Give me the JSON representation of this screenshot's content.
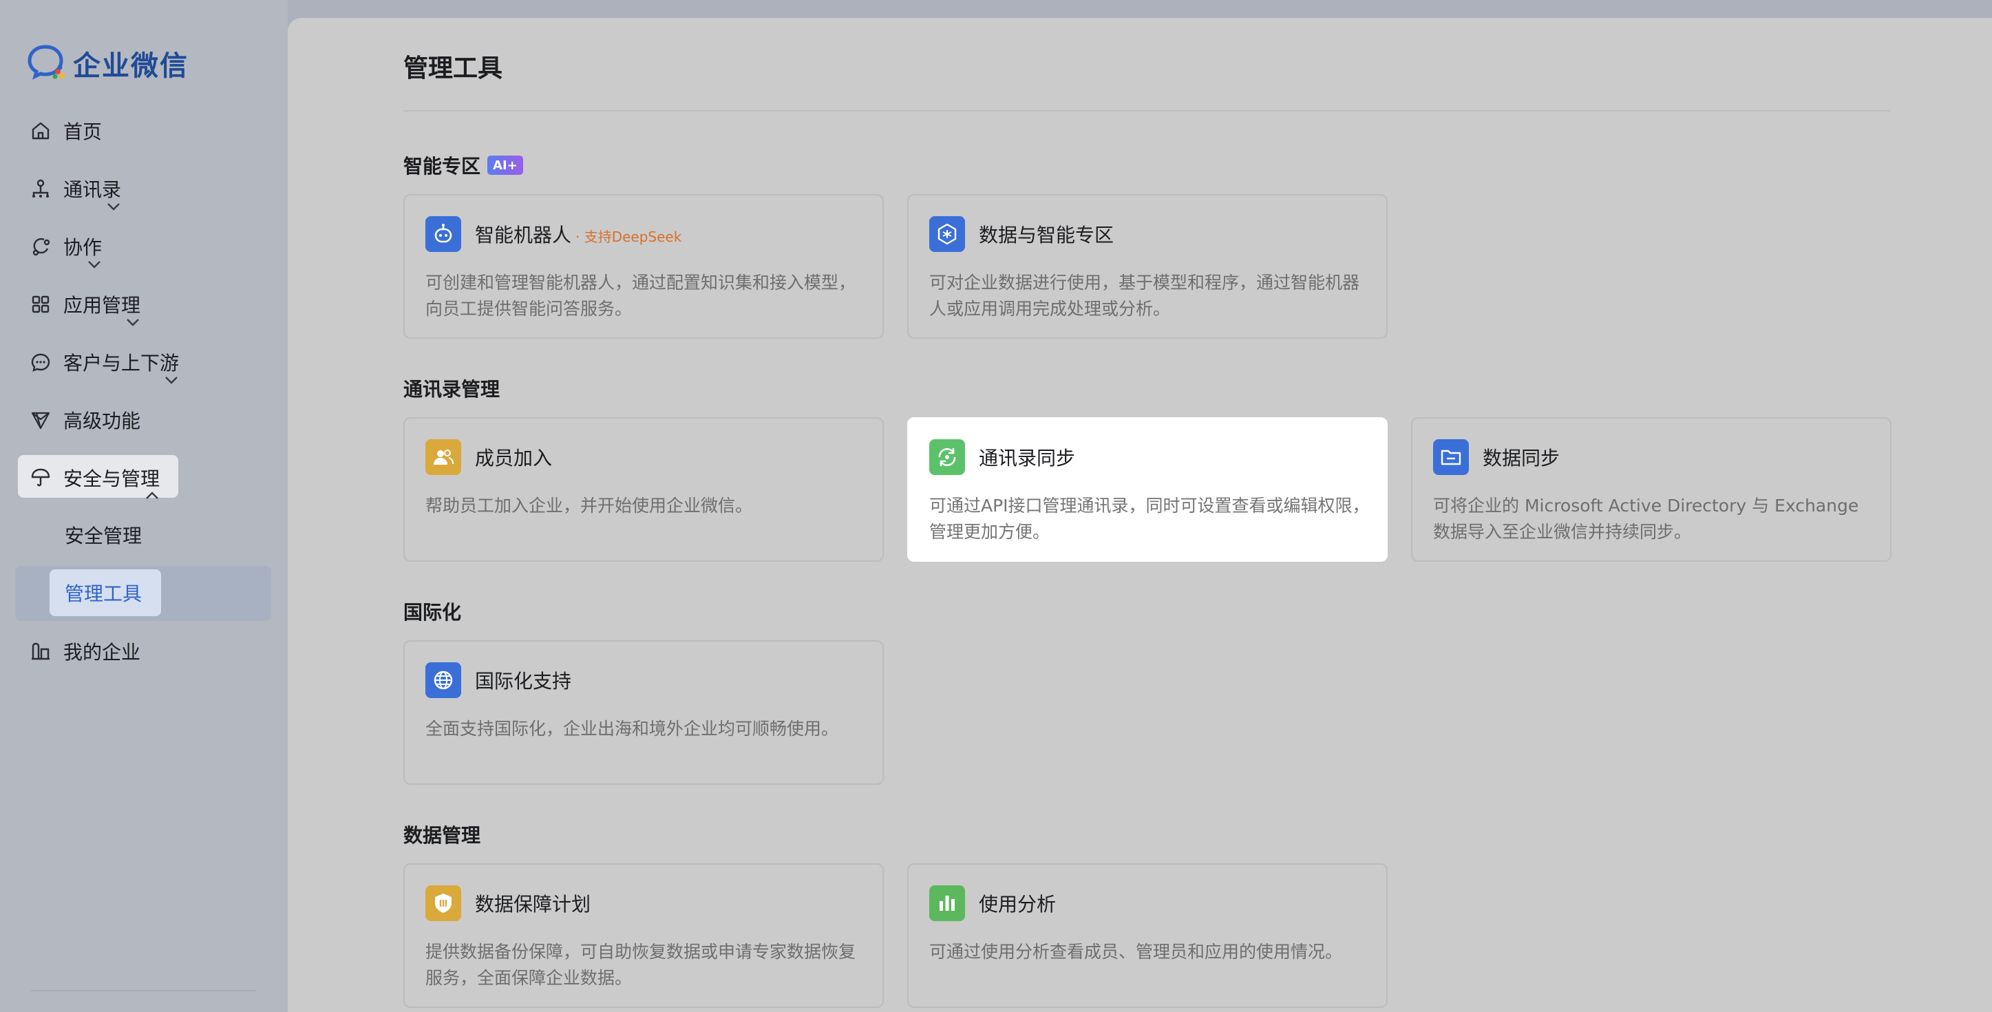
{
  "app": {
    "logo_text": "企业微信"
  },
  "sidebar": {
    "items": [
      {
        "label": "首页",
        "icon": "home-icon",
        "has_chevron": false
      },
      {
        "label": "通讯录",
        "icon": "org-chart-icon",
        "has_chevron": true
      },
      {
        "label": "协作",
        "icon": "collaboration-icon",
        "has_chevron": true
      },
      {
        "label": "应用管理",
        "icon": "apps-grid-icon",
        "has_chevron": true
      },
      {
        "label": "客户与上下游",
        "icon": "chat-bubble-icon",
        "has_chevron": true
      },
      {
        "label": "高级功能",
        "icon": "diamond-icon",
        "has_chevron": false
      },
      {
        "label": "安全与管理",
        "icon": "umbrella-icon",
        "has_chevron": true,
        "expanded": true
      },
      {
        "label": "我的企业",
        "icon": "building-icon",
        "has_chevron": false
      }
    ],
    "sub_items": [
      {
        "label": "安全管理"
      },
      {
        "label": "管理工具",
        "selected": true
      }
    ]
  },
  "main": {
    "page_title": "管理工具",
    "sections": [
      {
        "title": "智能专区",
        "badge": "AI+",
        "cards": [
          {
            "title": "智能机器人",
            "tag": "· 支持DeepSeek",
            "desc": "可创建和管理智能机器人，通过配置知识集和接入模型，向员工提供智能问答服务。",
            "icon": "robot-icon",
            "icon_color": "#3b6fd8"
          },
          {
            "title": "数据与智能专区",
            "desc": "可对企业数据进行使用，基于模型和程序，通过智能机器人或应用调用完成处理或分析。",
            "icon": "hexagon-data-icon",
            "icon_color": "#3b6fd8"
          }
        ]
      },
      {
        "title": "通讯录管理",
        "cards": [
          {
            "title": "成员加入",
            "desc": "帮助员工加入企业，并开始使用企业微信。",
            "icon": "members-icon",
            "icon_color": "#d9a93c"
          },
          {
            "title": "通讯录同步",
            "desc": "可通过API接口管理通讯录，同时可设置查看或编辑权限，管理更加方便。",
            "icon": "sync-icon",
            "icon_color": "#5cc26a",
            "highlight": true
          },
          {
            "title": "数据同步",
            "desc": "可将企业的 Microsoft Active Directory 与 Exchange 数据导入至企业微信并持续同步。",
            "icon": "folder-icon",
            "icon_color": "#3b6fd8"
          }
        ]
      },
      {
        "title": "国际化",
        "cards": [
          {
            "title": "国际化支持",
            "desc": "全面支持国际化，企业出海和境外企业均可顺畅使用。",
            "icon": "globe-icon",
            "icon_color": "#3b6fd8"
          }
        ]
      },
      {
        "title": "数据管理",
        "cards": [
          {
            "title": "数据保障计划",
            "desc": "提供数据备份保障，可自助恢复数据或申请专家数据恢复服务，全面保障企业数据。",
            "icon": "shield-icon",
            "icon_color": "#d9a93c"
          },
          {
            "title": "使用分析",
            "desc": "可通过使用分析查看成员、管理员和应用的使用情况。",
            "icon": "bar-chart-icon",
            "icon_color": "#5cb85c"
          }
        ]
      }
    ]
  }
}
